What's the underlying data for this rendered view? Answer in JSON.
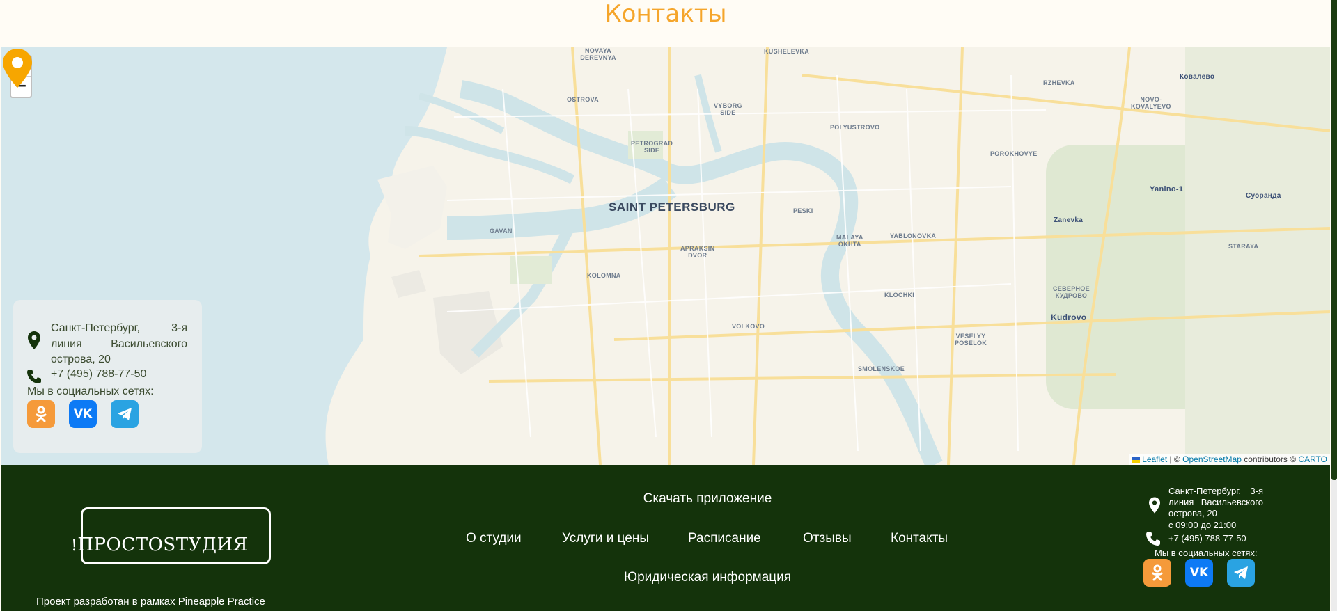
{
  "section": {
    "title": "Контакты"
  },
  "map": {
    "zoom_in": "+",
    "zoom_out": "−",
    "attribution": {
      "leaflet": "Leaflet",
      "sep": " | © ",
      "osm": "OpenStreetMap",
      "contrib": " contributors © ",
      "carto": "CARTO"
    },
    "labels": {
      "city": "SAINT PETERSBURG",
      "novaya": "NOVAYA\nDEREVNYA",
      "kushelevka": "KUSHELEVKA",
      "ostrova": "OSTROVA",
      "vyborg": "VYBORG\nSIDE",
      "petrograd": "PETROGRAD\nSIDE",
      "polyustrovo": "POLYUSTROVO",
      "rzhevka": "RZHEVKA",
      "kovalevo": "Ковалёво",
      "novokovalevo": "NOVO-\nKOVALYEVO",
      "porokhovye": "POROKHOVYE",
      "yanino": "Yanino-1",
      "suoranda": "Суоранда",
      "peski": "PESKI",
      "gavan": "GAVAN",
      "apraksin": "APRAKSIN\nDVOR",
      "malaya": "MALAYA\nOKHTA",
      "yablonovka": "YABLONOVKA",
      "zanevka": "Zanevka",
      "staraya": "STARAYA",
      "kolomna": "KOLOMNA",
      "klochki": "KLOCHKI",
      "severnoe": "СЕВЕРНОЕ\nКУДРОВО",
      "kudrovo": "Kudrovo",
      "volkovo": "VOLKOVO",
      "veselyy": "VESELYY\nPOSELOK",
      "smolenskoe": "SMOLENSKOE"
    }
  },
  "contact_card": {
    "address": "Санкт-Петербург, 3-я линия Васильевского острова, 20",
    "phone": "+7 (495) 788-77-50",
    "social_title": "Мы в социальных сетях:"
  },
  "footer": {
    "logo": "ПРОСТОSТУДИЯ",
    "credit": "Проект разработан в рамках Pineapple Practice",
    "download": "Скачать приложение",
    "nav": [
      "О студии",
      "Услуги и цены",
      "Расписание",
      "Отзывы",
      "Контакты"
    ],
    "legal": "Юридическая информация",
    "address": "Санкт-Петербург, 3-я линия Васильевского острова, 20",
    "hours": "с 09:00 до 21:00",
    "phone": "+7 (495) 788-77-50",
    "social_title": "Мы в социальных сетях:"
  },
  "colors": {
    "accent": "#f5a52a",
    "footer_bg": "#14330b",
    "ok": "#f59a3a",
    "vk": "#0d7af5",
    "tg": "#2aa3e2"
  },
  "icons": [
    "zoom-in-icon",
    "zoom-out-icon",
    "map-pin-icon",
    "location-icon",
    "phone-icon",
    "odnoklassniki-icon",
    "vk-icon",
    "telegram-icon"
  ]
}
